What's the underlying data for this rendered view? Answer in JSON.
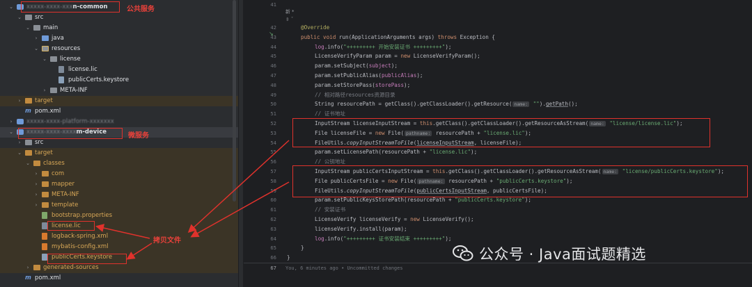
{
  "project_tree": {
    "rows": [
      {
        "name": "common-module",
        "kind": "module",
        "label_prefix": "xxxxx-xxxx-xxx",
        "label": "n-common",
        "chevron": "⌄",
        "blurred": true,
        "hl": false
      },
      {
        "name": "src",
        "kind": "folder",
        "label": "src",
        "chevron": "⌄",
        "hl": false
      },
      {
        "name": "main",
        "kind": "folder",
        "label": "main",
        "chevron": "⌄",
        "hl": false
      },
      {
        "name": "java",
        "kind": "folder-blue",
        "label": "java",
        "chevron": "›",
        "hl": false
      },
      {
        "name": "resources",
        "kind": "folder-res",
        "label": "resources",
        "chevron": "⌄",
        "hl": false
      },
      {
        "name": "license",
        "kind": "folder",
        "label": "license",
        "chevron": "⌄",
        "hl": false
      },
      {
        "name": "license-lic",
        "kind": "file-text",
        "label": "license.lic",
        "chevron": "",
        "hl": false
      },
      {
        "name": "publiccerts-keystore",
        "kind": "file-key",
        "label": "publicCerts.keystore",
        "chevron": "",
        "hl": false
      },
      {
        "name": "meta-inf",
        "kind": "folder",
        "label": "META-INF",
        "chevron": "›",
        "hl": false
      },
      {
        "name": "target",
        "kind": "folder-orange",
        "label": "target",
        "chevron": "›",
        "hl": true
      },
      {
        "name": "pom-xml",
        "kind": "file-m",
        "label": "pom.xml",
        "chevron": "",
        "hl": false
      },
      {
        "name": "platform-module",
        "kind": "module",
        "label": "xxxxx-xxxx-platform-xxxxxxx",
        "label_prefix": "",
        "chevron": "›",
        "blurred": true,
        "hl": false
      },
      {
        "name": "device-module",
        "kind": "module",
        "label_prefix": "xxxxx-xxxx-xxxx",
        "label": "m-device",
        "chevron": "⌄",
        "blurred": true,
        "hl": false,
        "sel": true
      },
      {
        "name": "src",
        "kind": "folder",
        "label": "src",
        "chevron": "›",
        "hl": false
      },
      {
        "name": "target",
        "kind": "folder-orange",
        "label": "target",
        "chevron": "⌄",
        "hl": true
      },
      {
        "name": "classes",
        "kind": "folder-orange",
        "label": "classes",
        "chevron": "⌄",
        "hl": true
      },
      {
        "name": "com",
        "kind": "folder-orange",
        "label": "com",
        "chevron": "›",
        "hl": true
      },
      {
        "name": "mapper",
        "kind": "folder-orange",
        "label": "mapper",
        "chevron": "›",
        "hl": true
      },
      {
        "name": "meta-inf",
        "kind": "folder-orange",
        "label": "META-INF",
        "chevron": "›",
        "hl": true
      },
      {
        "name": "template",
        "kind": "folder-orange",
        "label": "template",
        "chevron": "›",
        "hl": true
      },
      {
        "name": "bootstrap-properties",
        "kind": "file-prop",
        "label": "bootstrap.properties",
        "chevron": "",
        "hl": true
      },
      {
        "name": "license-lic",
        "kind": "file-text",
        "label": "license.lic",
        "chevron": "",
        "hl": true
      },
      {
        "name": "logback-spring-xml",
        "kind": "file-xml",
        "label": "logback-spring.xml",
        "chevron": "",
        "hl": true
      },
      {
        "name": "mybatis-config-xml",
        "kind": "file-xml",
        "label": "mybatis-config.xml",
        "chevron": "",
        "hl": true
      },
      {
        "name": "publiccerts-keystore",
        "kind": "file-key",
        "label": "publicCerts.keystore",
        "chevron": "",
        "hl": true
      },
      {
        "name": "generated-sources",
        "kind": "folder-orange",
        "label": "generated-sources",
        "chevron": "›",
        "hl": true
      },
      {
        "name": "pom-xml",
        "kind": "file-m",
        "label": "pom.xml",
        "chevron": "",
        "hl": false
      }
    ]
  },
  "annotations": {
    "common_service": "公共服务",
    "micro_service": "微服务",
    "copy_files": "拷贝文件"
  },
  "editor": {
    "top_line_number": "41",
    "hint_new": "新 *",
    "hint_mark": "⇳ ˇ",
    "status_line_number": "67",
    "status_text": "You, 6 minutes ago • Uncommitted changes"
  },
  "code_lines": [
    {
      "n": "42",
      "indent": 1,
      "html": "<span class='a'>@Override</span>"
    },
    {
      "n": "43",
      "indent": 1,
      "html": "<span class='k'>public void</span> run(ApplicationArguments args) <span class='k'>throws</span> Exception {"
    },
    {
      "n": "44",
      "indent": 2,
      "html": "<span class='f'>log</span>.info(<span class='s'>\"+++++++++ 开始安装证书 +++++++++\"</span>);"
    },
    {
      "n": "45",
      "indent": 2,
      "html": "LicenseVerifyParam param = <span class='k'>new</span> LicenseVerifyParam();"
    },
    {
      "n": "46",
      "indent": 2,
      "html": "param.setSubject(<span class='f'>subject</span>);"
    },
    {
      "n": "47",
      "indent": 2,
      "html": "param.setPublicAlias(<span class='f'>publicAlias</span>);"
    },
    {
      "n": "48",
      "indent": 2,
      "html": "param.setStorePass(<span class='f'>storePass</span>);"
    },
    {
      "n": "49",
      "indent": 2,
      "html": "<span class='c'>// 相对路径resources资源目录</span>"
    },
    {
      "n": "50",
      "indent": 2,
      "html": "String resourcePath = getClass().getClassLoader().getResource(<span class='hint'>name:</span> <span class='s'>\"\"</span>).<span class='u'>getPath</span>();"
    },
    {
      "n": "51",
      "indent": 2,
      "html": "<span class='c'>// 证书地址</span>"
    },
    {
      "n": "52",
      "indent": 2,
      "html": "InputStream licenseInputStream = <span class='k'>this</span>.getClass().getClassLoader().getResourceAsStream(<span class='hint'>name:</span> <span class='s'>\"license/license.lic\"</span>);"
    },
    {
      "n": "53",
      "indent": 2,
      "html": "File licenseFile = <span class='k'>new</span> File(<span class='hint'>pathname:</span> resourcePath + <span class='s'>\"license.lic\"</span>);"
    },
    {
      "n": "54",
      "indent": 2,
      "html": "FileUtils.<span class='it'>copyInputStreamToFile</span>(<span class='u'>licenseInputStream</span>, licenseFile);"
    },
    {
      "n": "55",
      "indent": 2,
      "html": "param.setLicensePath(resourcePath + <span class='s'>\"license.lic\"</span>);"
    },
    {
      "n": "56",
      "indent": 2,
      "html": "<span class='c'>// 公钥地址</span>"
    },
    {
      "n": "57",
      "indent": 2,
      "html": "InputStream publicCertsInputStream = <span class='k'>this</span>.getClass().getClassLoader().getResourceAsStream(<span class='hint'>name:</span> <span class='s'>\"license/publicCerts.keystore\"</span>);"
    },
    {
      "n": "58",
      "indent": 2,
      "html": "File publicCertsFile = <span class='k'>new</span> File(<span class='hint'>pathname:</span> resourcePath + <span class='s'>\"publicCerts.keystore\"</span>);"
    },
    {
      "n": "59",
      "indent": 2,
      "html": "FileUtils.<span class='it'>copyInputStreamToFile</span>(<span class='u'>publicCertsInputStream</span>, publicCertsFile);"
    },
    {
      "n": "60",
      "indent": 2,
      "html": "param.setPublicKeysStorePath(resourcePath + <span class='s'>\"publicCerts.keystore\"</span>);"
    },
    {
      "n": "61",
      "indent": 2,
      "html": "<span class='c'>// 安装证书</span>"
    },
    {
      "n": "62",
      "indent": 2,
      "html": "LicenseVerify licenseVerify = <span class='k'>new</span> LicenseVerify();"
    },
    {
      "n": "63",
      "indent": 2,
      "html": "licenseVerify.install(param);"
    },
    {
      "n": "64",
      "indent": 2,
      "html": "<span class='f'>log</span>.info(<span class='s'>\"+++++++++ 证书安装结束 +++++++++\"</span>);"
    },
    {
      "n": "65",
      "indent": 1,
      "html": "}"
    },
    {
      "n": "66",
      "indent": 0,
      "html": "}"
    }
  ],
  "watermark": {
    "text": "公众号 · Java面试题精选",
    "icon": "wechat-icon"
  },
  "colors": {
    "accent_red": "#e0322c",
    "keyword": "#cf8e6d",
    "string": "#6aab73",
    "comment": "#7a7e85",
    "annotation": "#b3ae60",
    "field": "#c77dbb"
  }
}
